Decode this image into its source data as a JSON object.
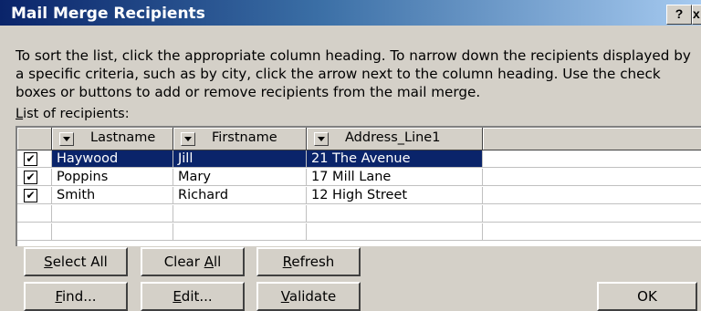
{
  "window": {
    "title": "Mail Merge Recipients",
    "help_label": "?",
    "close_label": "x"
  },
  "instructions": "To sort the list, click the appropriate column heading.  To narrow down the recipients displayed by a specific criteria, such as by city, click the arrow next to the column heading.  Use the check boxes or buttons to add or remove recipients from the mail merge.",
  "list_label": {
    "accel": "L",
    "rest": "ist of recipients:"
  },
  "columns": [
    "Lastname",
    "Firstname",
    "Address_Line1"
  ],
  "rows": [
    {
      "checked": true,
      "lastname": "Haywood",
      "firstname": "Jill",
      "address": "21 The Avenue",
      "selected": true
    },
    {
      "checked": true,
      "lastname": "Poppins",
      "firstname": "Mary",
      "address": "17 Mill Lane",
      "selected": false
    },
    {
      "checked": true,
      "lastname": "Smith",
      "firstname": "Richard",
      "address": "12 High Street",
      "selected": false
    }
  ],
  "buttons": {
    "select_all": {
      "accel": "S",
      "rest": "elect All"
    },
    "clear_all": {
      "pre": "Clear ",
      "accel": "A",
      "rest": "ll"
    },
    "refresh": {
      "accel": "R",
      "rest": "efresh"
    },
    "find": {
      "accel": "F",
      "rest": "ind..."
    },
    "edit": {
      "accel": "E",
      "rest": "dit..."
    },
    "validate": {
      "accel": "V",
      "rest": "alidate"
    },
    "ok": "OK"
  },
  "checkmark": "✔"
}
